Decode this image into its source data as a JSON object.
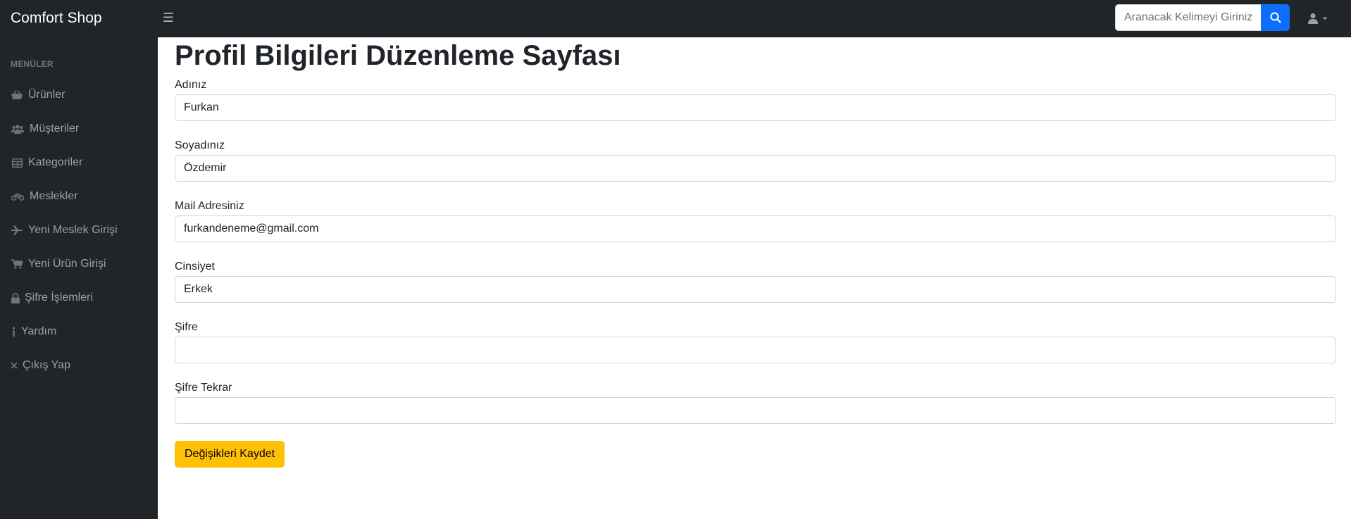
{
  "brand": "Comfort Shop",
  "search": {
    "placeholder": "Aranacak Kelimeyi Giriniz.",
    "value": ""
  },
  "sidebar": {
    "heading": "MENÜLER",
    "items": [
      {
        "label": "Ürünler",
        "icon": "basket-icon"
      },
      {
        "label": "Müşteriler",
        "icon": "users-icon"
      },
      {
        "label": "Kategoriler",
        "icon": "table-icon"
      },
      {
        "label": "Meslekler",
        "icon": "bicycle-icon"
      },
      {
        "label": "Yeni Meslek Girişi",
        "icon": "plane-icon"
      },
      {
        "label": "Yeni Ürün Girişi",
        "icon": "cart-icon"
      },
      {
        "label": "Şifre İşlemleri",
        "icon": "lock-icon"
      },
      {
        "label": "Yardım",
        "icon": "info-icon"
      },
      {
        "label": "Çıkış Yap",
        "icon": "close-icon"
      }
    ]
  },
  "main": {
    "title": "Profil Bilgileri Düzenleme Sayfası",
    "fields": [
      {
        "label": "Adınız",
        "value": "Furkan"
      },
      {
        "label": "Soyadınız",
        "value": "Özdemir"
      },
      {
        "label": "Mail Adresiniz",
        "value": "furkandeneme@gmail.com"
      },
      {
        "label": "Cinsiyet",
        "value": "Erkek"
      },
      {
        "label": "Şifre",
        "value": ""
      },
      {
        "label": "Şifre Tekrar",
        "value": ""
      }
    ],
    "save_label": "Değişikleri Kaydet"
  },
  "colors": {
    "navbar": "#212529",
    "primary": "#0d6efd",
    "warning": "#ffc107",
    "sidebar_text": "#9aa0a6"
  }
}
